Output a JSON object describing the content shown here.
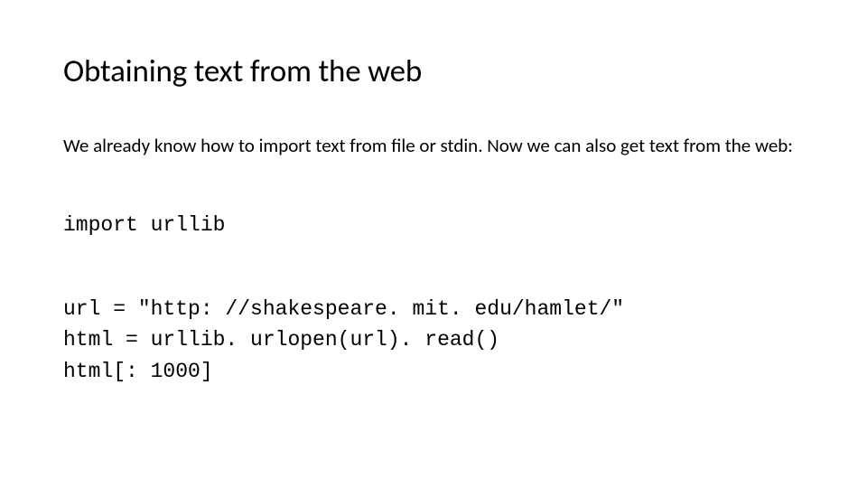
{
  "slide": {
    "title": "Obtaining text from the web",
    "body": "We already know how to import text from file or stdin. Now we can also get text from the web:",
    "code1": "import urllib",
    "code2_line1": "url = \"http: //shakespeare. mit. edu/hamlet/\"",
    "code2_line2": "html = urllib. urlopen(url). read()",
    "code2_line3": "html[: 1000]"
  }
}
